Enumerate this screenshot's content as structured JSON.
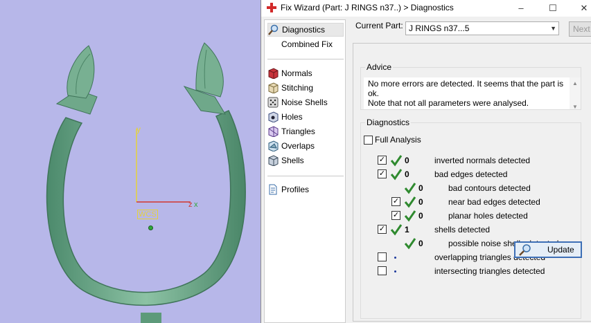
{
  "window": {
    "title": "Fix Wizard (Part: J RINGS n37..) > Diagnostics"
  },
  "viewport": {
    "wcs_label": "WCS",
    "axis_x": "x",
    "axis_y": "y",
    "axis_z": "z"
  },
  "nav": {
    "items": [
      {
        "label": "Diagnostics",
        "icon": "magnifier-icon",
        "selected": true
      },
      {
        "label": "Combined Fix",
        "icon": "blank-icon"
      },
      {
        "label": "Normals",
        "icon": "cube-icon"
      },
      {
        "label": "Stitching",
        "icon": "stitch-icon"
      },
      {
        "label": "Noise Shells",
        "icon": "dice-icon"
      },
      {
        "label": "Holes",
        "icon": "holes-icon"
      },
      {
        "label": "Triangles",
        "icon": "triangles-icon"
      },
      {
        "label": "Overlaps",
        "icon": "overlaps-icon"
      },
      {
        "label": "Shells",
        "icon": "shells-icon"
      },
      {
        "label": "Profiles",
        "icon": "document-icon"
      }
    ]
  },
  "part": {
    "label": "Current Part:",
    "value": "J RINGS n37...5",
    "next": "Next"
  },
  "advice": {
    "title": "Advice",
    "line1": "No more errors are detected. It seems that the part is ok.",
    "line2": "Note that not all parameters were analysed."
  },
  "diagnostics": {
    "title": "Diagnostics",
    "full_analysis": "Full Analysis",
    "rows": [
      {
        "count": "0",
        "text": "inverted normals detected",
        "checked": true,
        "status": "ok"
      },
      {
        "count": "0",
        "text": "bad edges detected",
        "checked": true,
        "status": "ok"
      },
      {
        "count": "0",
        "text": "bad contours detected",
        "checked": null,
        "status": "ok"
      },
      {
        "count": "0",
        "text": "near bad edges detected",
        "checked": true,
        "status": "ok"
      },
      {
        "count": "0",
        "text": "planar holes detected",
        "checked": true,
        "status": "ok"
      },
      {
        "count": "1",
        "text": "shells detected",
        "checked": true,
        "status": "ok"
      },
      {
        "count": "0",
        "text": "possible noise shells detected",
        "checked": null,
        "status": "ok"
      },
      {
        "count": "",
        "text": "overlapping triangles detected",
        "checked": false,
        "status": "none"
      },
      {
        "count": "",
        "text": "intersecting triangles detected",
        "checked": false,
        "status": "none"
      }
    ],
    "update": "Update"
  },
  "colors": {
    "viewport_bg": "#b7b7e9",
    "ring": "#6fa88a",
    "check": "#2f8a2f",
    "accent": "#3d6fb6"
  }
}
